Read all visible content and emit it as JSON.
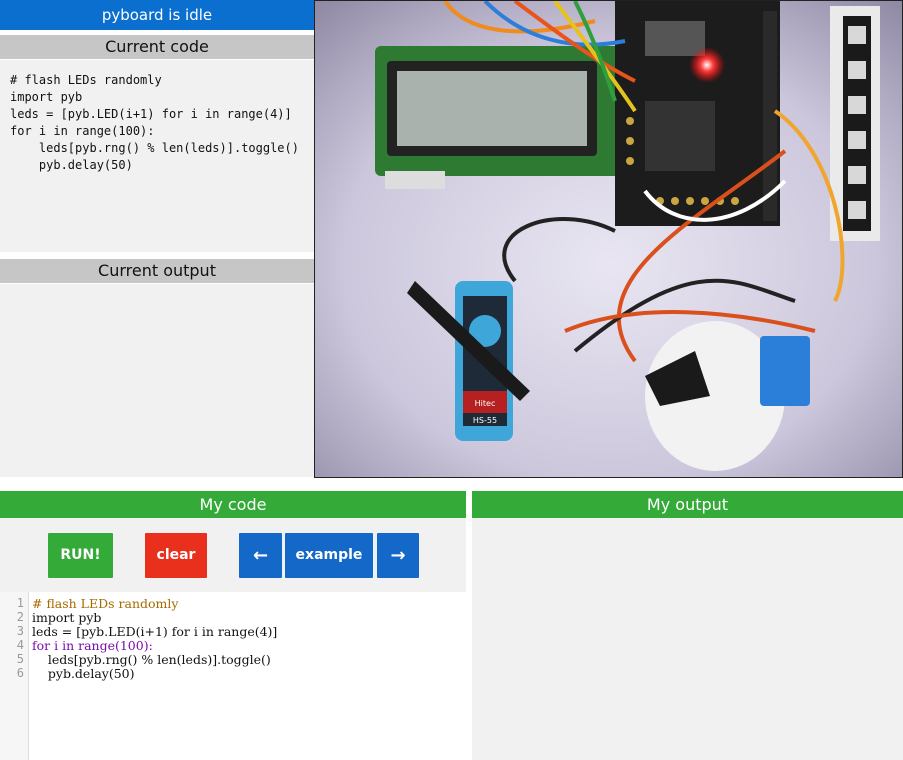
{
  "status": {
    "text": "pyboard is idle"
  },
  "current_code": {
    "title": "Current code",
    "lines": [
      "# flash LEDs randomly",
      "import pyb",
      "leds = [pyb.LED(i+1) for i in range(4)]",
      "for i in range(100):",
      "    leds[pyb.rng() % len(leds)].toggle()",
      "    pyb.delay(50)"
    ]
  },
  "current_output": {
    "title": "Current output",
    "text": ""
  },
  "camera": {
    "label": "HS-55",
    "brand": "Hitec"
  },
  "my_code": {
    "title": "My code",
    "run_label": "RUN!",
    "clear_label": "clear",
    "prev_label": "←",
    "example_label": "example",
    "next_label": "→",
    "editor_lines": [
      "# flash LEDs randomly",
      "import pyb",
      "leds = [pyb.LED(i+1) for i in range(4)]",
      "for i in range(100):",
      "    leds[pyb.rng() % len(leds)].toggle()",
      "    pyb.delay(50)"
    ],
    "line_numbers": [
      "1",
      "2",
      "3",
      "4",
      "5",
      "6"
    ]
  },
  "my_output": {
    "title": "My output",
    "text": ""
  },
  "colors": {
    "status_blue": "#0b6fd0",
    "header_green": "#34aa39",
    "run_green": "#34aa39",
    "clear_red": "#e8301c",
    "nav_blue": "#1468c8"
  }
}
